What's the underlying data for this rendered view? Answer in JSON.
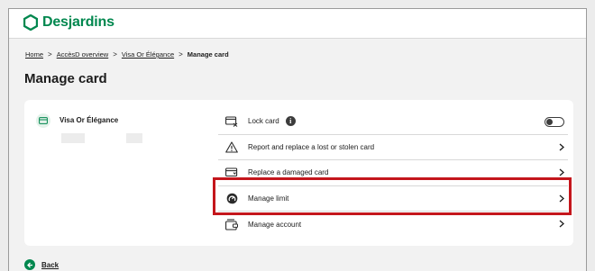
{
  "brand": {
    "name": "Desjardins",
    "color": "#00874e"
  },
  "breadcrumb": {
    "items": [
      "Home",
      "AccèsD overview",
      "Visa Or Élégance"
    ],
    "current": "Manage card",
    "separator": ">"
  },
  "page": {
    "title": "Manage card"
  },
  "card": {
    "name": "Visa Or Élégance"
  },
  "actions": {
    "lock": {
      "label": "Lock card",
      "info": "i",
      "toggle_on": false
    },
    "report": {
      "label": "Report and replace a lost or stolen card"
    },
    "replace": {
      "label": "Replace a damaged card"
    },
    "limit": {
      "label": "Manage limit"
    },
    "account": {
      "label": "Manage account"
    }
  },
  "back": {
    "label": "Back"
  },
  "colors": {
    "highlight": "#c4161c",
    "accent": "#00874e"
  }
}
